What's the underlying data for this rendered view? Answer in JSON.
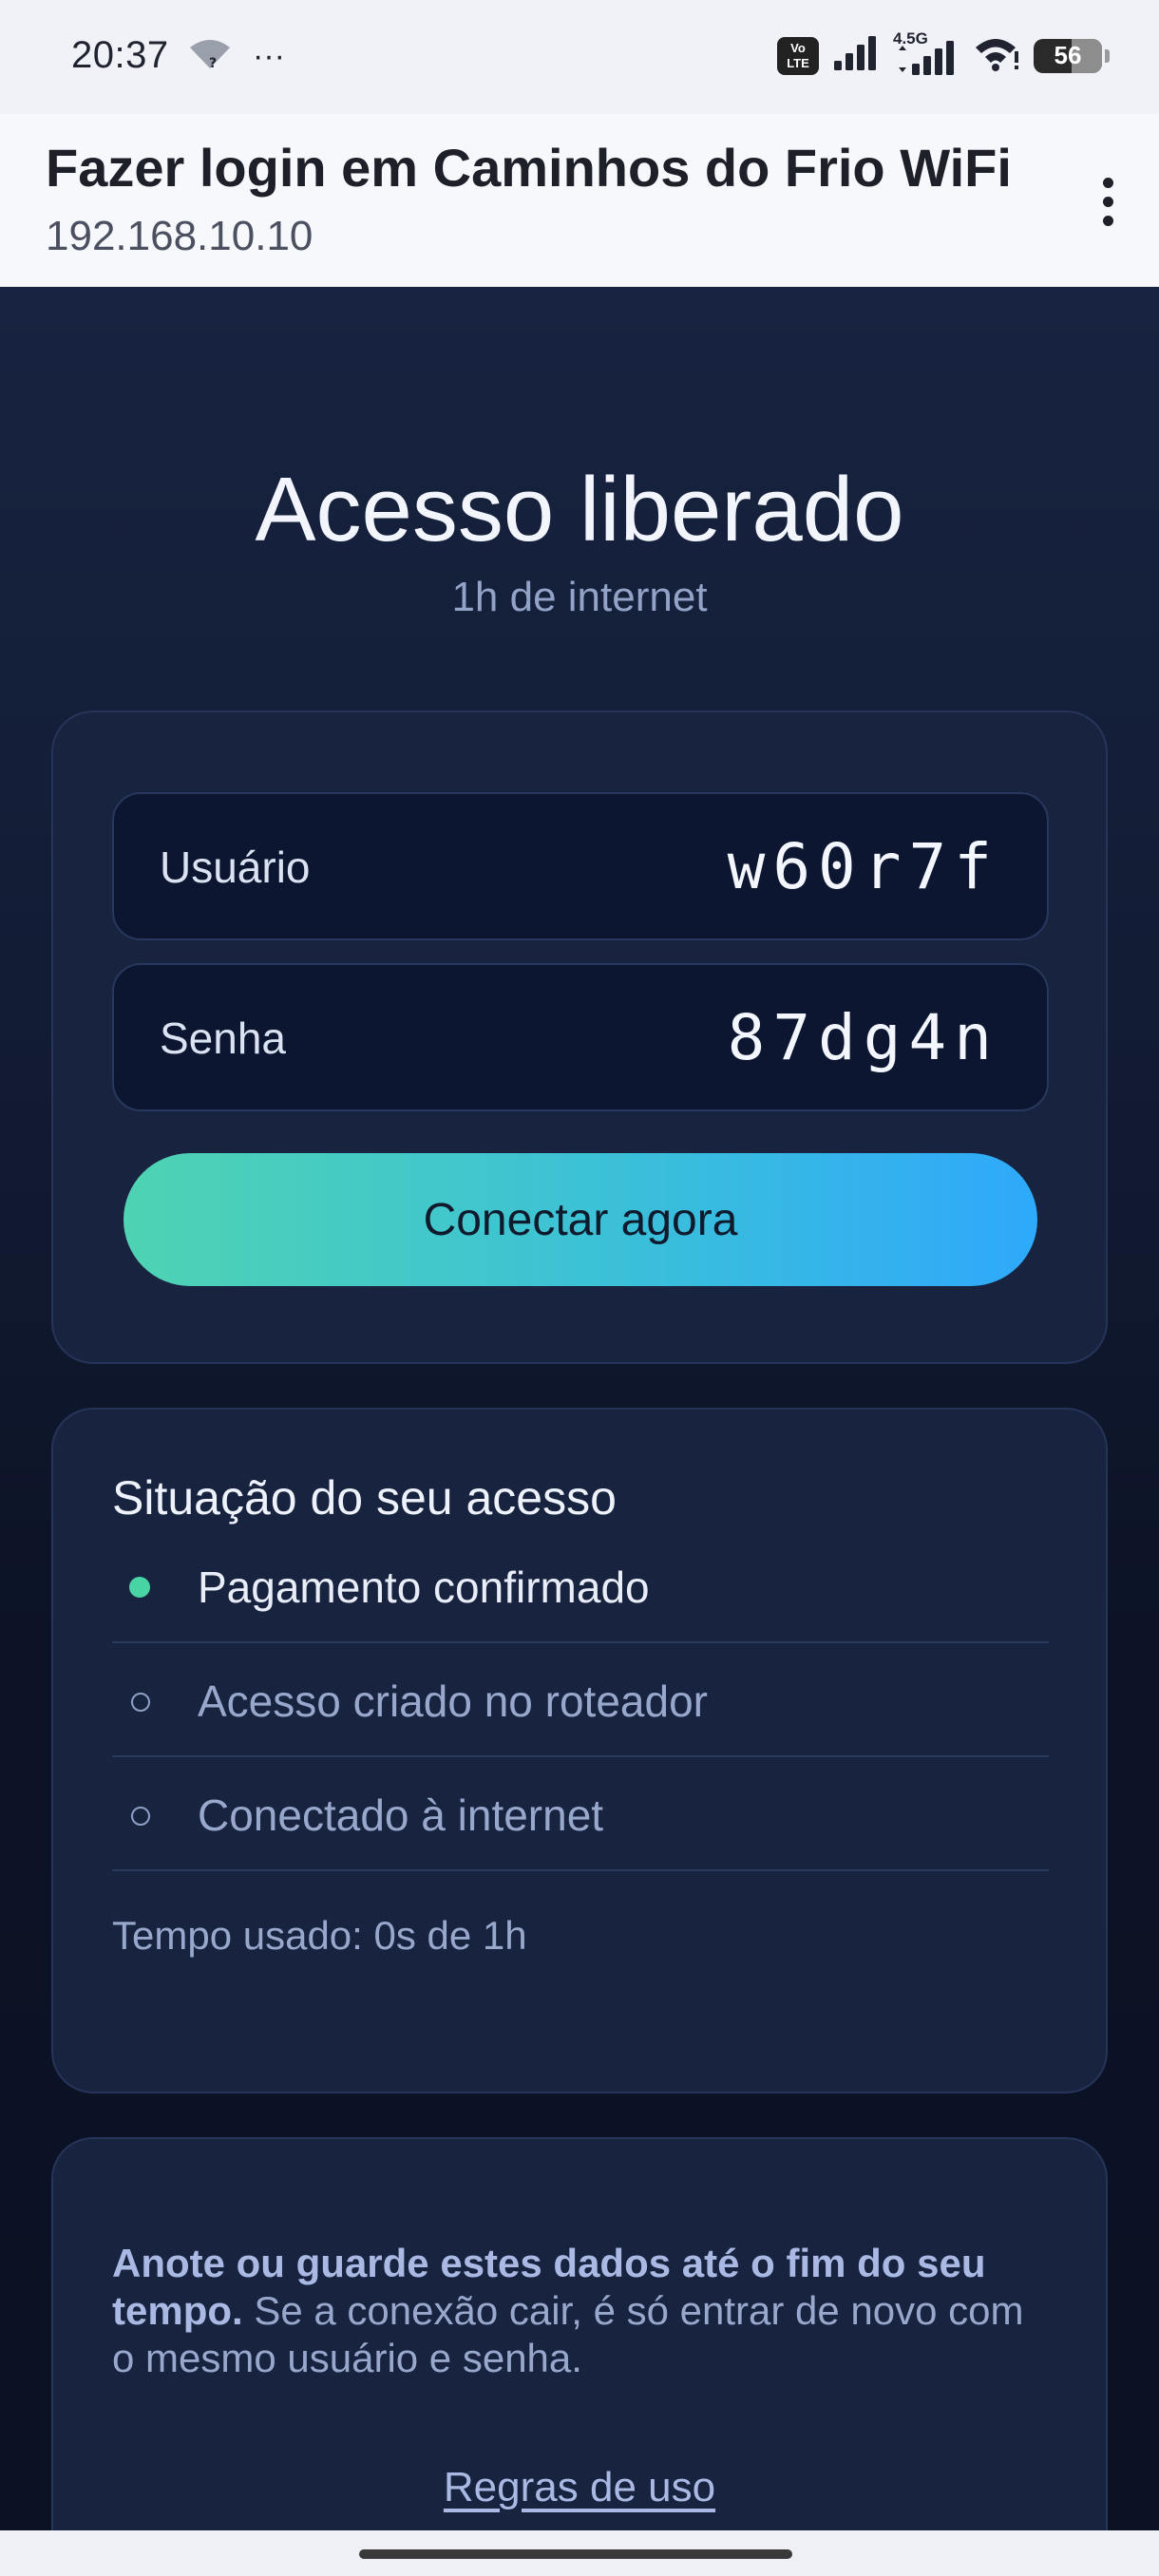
{
  "status_bar": {
    "time": "20:37",
    "overflow_indicator": "···",
    "volte_lines": [
      "Vo",
      "LTE"
    ],
    "network_type": "4.5G",
    "battery": "56",
    "battery_level": 0.56,
    "icons": [
      "wifi-unknown-icon",
      "volte-icon",
      "signal-icon",
      "signal-4.5g-icon",
      "wifi-icon",
      "battery-icon"
    ]
  },
  "app_bar": {
    "title": "Fazer login em Caminhos do Frio WiFi",
    "url": "192.168.10.10",
    "menu_icon": "more-vertical-icon"
  },
  "hero": {
    "title": "Acesso liberado",
    "subtitle": "1h de internet"
  },
  "credentials": {
    "user_label": "Usuário",
    "user_value": "w60r7f",
    "password_label": "Senha",
    "password_value": "87dg4n",
    "connect_label": "Conectar agora"
  },
  "status": {
    "title": "Situação do seu acesso",
    "items": [
      {
        "label": "Pagamento confirmado",
        "done": true
      },
      {
        "label": "Acesso criado no roteador",
        "done": false
      },
      {
        "label": "Conectado à internet",
        "done": false
      }
    ],
    "time_used": "Tempo usado: 0s de 1h"
  },
  "notice": {
    "bold": "Anote ou guarde estes dados até o fim do seu tempo.",
    "text": " Se a conexão cair, é só entrar de novo com o mesmo usuário e senha.",
    "rules_link": "Regras de uso"
  },
  "colors": {
    "accent_green": "#49d4a6",
    "button_gradient_start": "#4fd3b3",
    "button_gradient_end": "#2ea9fb",
    "background": "#0c1326",
    "card": "#18233f"
  }
}
